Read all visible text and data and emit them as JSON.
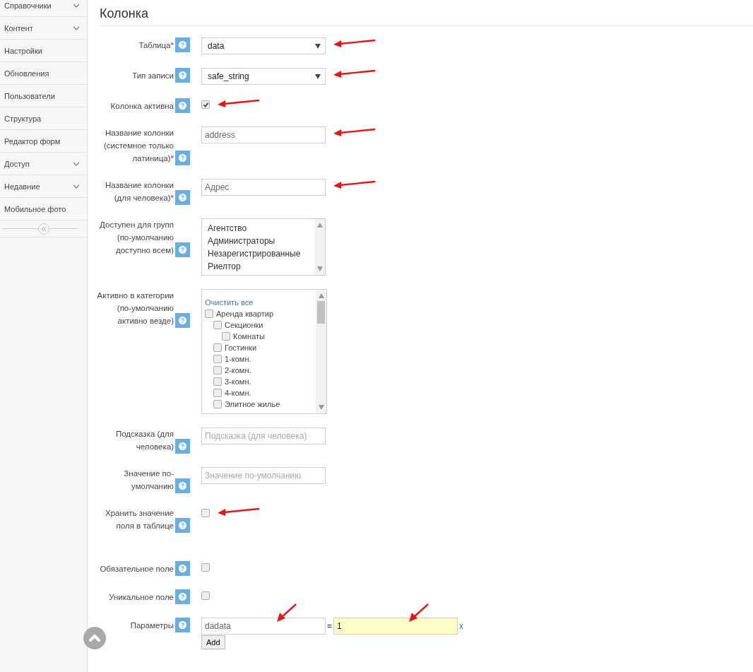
{
  "sidebar": {
    "items": [
      {
        "label": "Справочники",
        "expandable": true
      },
      {
        "label": "Контент",
        "expandable": true
      },
      {
        "label": "Настройки",
        "expandable": false
      },
      {
        "label": "Обновления",
        "expandable": false
      },
      {
        "label": "Пользователи",
        "expandable": false
      },
      {
        "label": "Структура",
        "expandable": false
      },
      {
        "label": "Редактор форм",
        "expandable": false
      },
      {
        "label": "Доступ",
        "expandable": true
      },
      {
        "label": "Недавние",
        "expandable": true
      },
      {
        "label": "Мобильное фото",
        "expandable": false
      }
    ]
  },
  "page_title": "Колонка",
  "fields": [
    {
      "kind": "select",
      "label": "Таблица",
      "required_mark": "*",
      "value": "data",
      "arrow": true
    },
    {
      "kind": "select",
      "label": "Тип записи",
      "value": "safe_string",
      "arrow": true
    },
    {
      "kind": "checkbox",
      "label": "Колонка активна",
      "checked": true,
      "arrow": true
    },
    {
      "kind": "text",
      "label": "Название колонки (системное только латиница)",
      "required_mark": "*",
      "value": "address",
      "arrow": true
    },
    {
      "kind": "text",
      "label": "Название колонки (для человека)",
      "required_mark": "*",
      "value": "Адрес",
      "arrow": true
    },
    {
      "kind": "multiselect",
      "label": "Доступен для групп (по-умолчанию доступно всем)",
      "options": [
        "Агентство",
        "Администраторы",
        "Незарегистрированные",
        "Риелтор"
      ]
    },
    {
      "kind": "tree",
      "label": "Активно в категории (по-умолчанию активно везде)",
      "clear_link": "Очистить все",
      "items": [
        {
          "label": "Аренда квартир",
          "checked": false,
          "children": [
            {
              "label": "Секционки",
              "checked": false,
              "children": [
                {
                  "label": "Комнаты",
                  "checked": false
                }
              ]
            },
            {
              "label": "Гостинки",
              "checked": false
            },
            {
              "label": "1-комн.",
              "checked": false
            },
            {
              "label": "2-комн.",
              "checked": false
            },
            {
              "label": "3-комн.",
              "checked": false
            },
            {
              "label": "4-комн.",
              "checked": false
            },
            {
              "label": "Элитное жилье",
              "checked": false
            }
          ]
        }
      ]
    },
    {
      "kind": "text",
      "label": "Подсказка (для человека)",
      "placeholder": "Подсказка (для человека)"
    },
    {
      "kind": "text",
      "label": "Значение по-умолчанию",
      "placeholder": "Значение по-умолчанию"
    },
    {
      "kind": "checkbox",
      "label": "Хранить значение поля в таблице",
      "checked": false,
      "arrow": true
    },
    {
      "kind": "checkbox",
      "label": "Обязательное поле",
      "checked": false
    },
    {
      "kind": "checkbox",
      "label": "Уникальное поле",
      "checked": false
    },
    {
      "kind": "params",
      "label": "Параметры",
      "key": "dadata",
      "separator": "=",
      "value": "1",
      "remove": "x",
      "add_button": "Add",
      "key_arrow": true,
      "value_arrow": true
    }
  ]
}
